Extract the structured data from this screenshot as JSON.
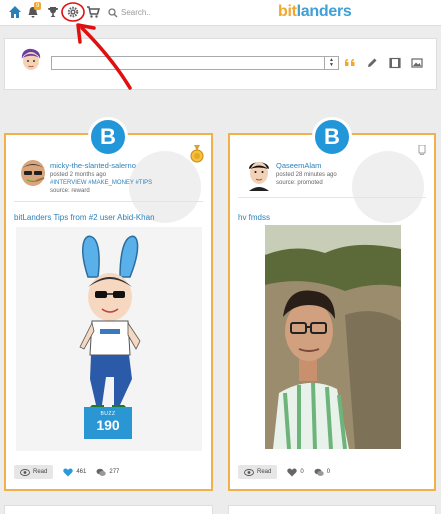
{
  "nav": {
    "notification_count": "9",
    "search_placeholder": "Search..",
    "logo_prefix": "bit",
    "logo_suffix": "landers"
  },
  "compose": {
    "input_value": "",
    "input_placeholder": ""
  },
  "posts": [
    {
      "author": "micky-the-slanted-salerno",
      "posted": "posted 2 months ago",
      "hashtags": "#INTERVIEW #MAKE_MONEY #TIPS",
      "source": "source: reward",
      "title": "bitLanders Tips from #2 user Abid-Khan",
      "buzz_label": "BUZZ",
      "buzz_value": "190",
      "read_label": "Read",
      "likes": "461",
      "comments": "277",
      "liked": true
    },
    {
      "author": "QaseemAlam",
      "posted": "posted 28 minutes ago",
      "source": "source: promoted",
      "title": "hv fmdss",
      "read_label": "Read",
      "likes": "0",
      "comments": "0",
      "liked": false
    }
  ],
  "colors": {
    "accent_blue": "#2196d8",
    "card_border": "#f0b14a",
    "annotation_red": "#e01010"
  }
}
